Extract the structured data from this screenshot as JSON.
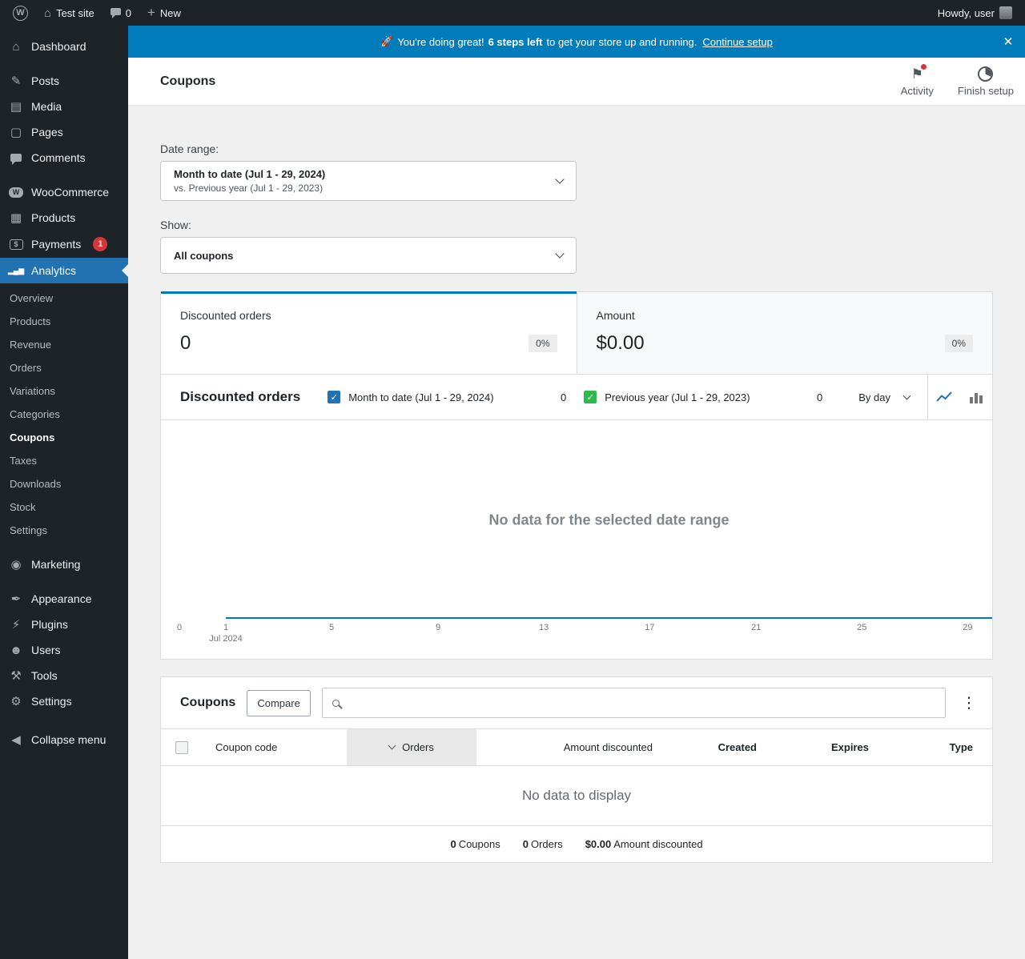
{
  "admin_bar": {
    "wp_logo_letter": "W",
    "site_name": "Test site",
    "comments_count": "0",
    "new_label": "New",
    "howdy": "Howdy, user"
  },
  "icons": {
    "home": "⌂",
    "plus": "+",
    "flag": "⚑",
    "close": "✕",
    "kebab": "⋮",
    "check": "✓"
  },
  "banner": {
    "emoji": "🚀",
    "message_start": "You're doing great!",
    "steps_left": "6 steps left",
    "message_end": "to get your store up and running.",
    "link_label": "Continue setup"
  },
  "header": {
    "title": "Coupons",
    "activity_label": "Activity",
    "finish_setup_label": "Finish setup"
  },
  "sidebar": {
    "items": [
      {
        "label": "Dashboard",
        "icon": "⌂"
      },
      {
        "label": "Posts",
        "icon": "✎"
      },
      {
        "label": "Media",
        "icon": "▤"
      },
      {
        "label": "Pages",
        "icon": "▢"
      },
      {
        "label": "Comments"
      },
      {
        "label": "WooCommerce",
        "icon": "W"
      },
      {
        "label": "Products",
        "icon": "▦"
      },
      {
        "label": "Payments",
        "icon": "$",
        "badge": "1"
      },
      {
        "label": "Analytics",
        "icon": "▂▄▆"
      },
      {
        "label": "Marketing",
        "icon": "◉"
      },
      {
        "label": "Appearance",
        "icon": "✒"
      },
      {
        "label": "Plugins",
        "icon": "⚡"
      },
      {
        "label": "Users",
        "icon": "☻"
      },
      {
        "label": "Tools",
        "icon": "⚒"
      },
      {
        "label": "Settings",
        "icon": "⚙"
      },
      {
        "label": "Collapse menu",
        "icon": "◀"
      }
    ],
    "analytics_submenu": [
      {
        "label": "Overview"
      },
      {
        "label": "Products"
      },
      {
        "label": "Revenue"
      },
      {
        "label": "Orders"
      },
      {
        "label": "Variations"
      },
      {
        "label": "Categories"
      },
      {
        "label": "Coupons"
      },
      {
        "label": "Taxes"
      },
      {
        "label": "Downloads"
      },
      {
        "label": "Stock"
      },
      {
        "label": "Settings"
      }
    ]
  },
  "filters": {
    "date_range_label": "Date range:",
    "date_range_primary": "Month to date (Jul 1 - 29, 2024)",
    "date_range_secondary": "vs. Previous year (Jul 1 - 29, 2023)",
    "show_label": "Show:",
    "show_value": "All coupons"
  },
  "summary": {
    "tiles": [
      {
        "label": "Discounted orders",
        "value": "0",
        "delta": "0%"
      },
      {
        "label": "Amount",
        "value": "$0.00",
        "delta": "0%"
      }
    ]
  },
  "chart": {
    "title": "Discounted orders",
    "series": [
      {
        "label": "Month to date (Jul 1 - 29, 2024)",
        "value": "0",
        "color": "#2271b1"
      },
      {
        "label": "Previous year (Jul 1 - 29, 2023)",
        "value": "0",
        "color": "#2eb94e"
      }
    ],
    "interval_label": "By day",
    "empty_message": "No data for the selected date range",
    "y_zero": "0",
    "x_ticks": [
      "1",
      "5",
      "9",
      "13",
      "17",
      "21",
      "25",
      "29"
    ],
    "x_month": "Jul 2024"
  },
  "table": {
    "title": "Coupons",
    "compare_label": "Compare",
    "search_placeholder": "",
    "columns": [
      {
        "label": "Coupon code"
      },
      {
        "label": "Orders",
        "sorted": true
      },
      {
        "label": "Amount discounted"
      },
      {
        "label": "Created"
      },
      {
        "label": "Expires"
      },
      {
        "label": "Type"
      }
    ],
    "empty_message": "No data to display",
    "summary": [
      {
        "value": "0",
        "label": "Coupons"
      },
      {
        "value": "0",
        "label": "Orders"
      },
      {
        "value": "$0.00",
        "label": "Amount discounted"
      }
    ]
  },
  "colors": {
    "banner_blue": "#007cba",
    "accent_blue": "#2271b1",
    "series_secondary_green": "#2eb94e",
    "badge_red": "#d63638",
    "sidebar_dark": "#1d2327"
  }
}
